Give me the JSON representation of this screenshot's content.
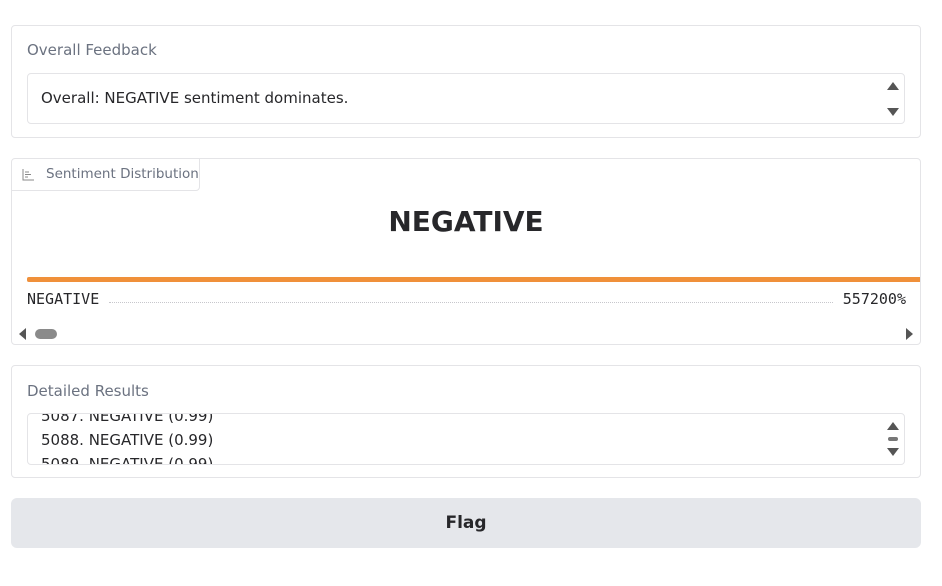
{
  "feedback": {
    "label": "Overall Feedback",
    "value": "Overall: NEGATIVE sentiment dominates."
  },
  "distribution": {
    "tab_label": "Sentiment Distribution",
    "top_label": "NEGATIVE",
    "bars": [
      {
        "label": "NEGATIVE",
        "value_text": "557200%",
        "fill_fraction": 1.0
      }
    ],
    "bar_color": "#f0903a"
  },
  "details": {
    "label": "Detailed Results",
    "lines": [
      "5087. NEGATIVE (0.99)",
      "5088. NEGATIVE (0.99)",
      "5089. NEGATIVE (0.99)"
    ]
  },
  "flag_button": {
    "label": "Flag"
  }
}
